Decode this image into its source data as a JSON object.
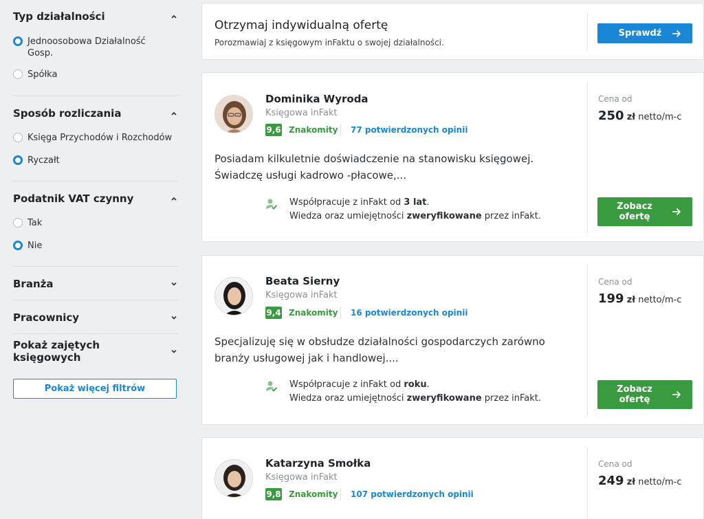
{
  "filters": {
    "type": {
      "title": "Typ działalności",
      "options": [
        "Jednoosobowa Działalność Gosp.",
        "Spółka"
      ],
      "selected": 0
    },
    "settlement": {
      "title": "Sposób rozliczania",
      "options": [
        "Księga Przychodów i Rozchodów",
        "Ryczałt"
      ],
      "selected": 1
    },
    "vat": {
      "title": "Podatnik VAT czynny",
      "options": [
        "Tak",
        "Nie"
      ],
      "selected": 1
    },
    "collapsed": [
      "Branża",
      "Pracownicy",
      "Pokaż zajętych księgowych"
    ],
    "more_button": "Pokaż więcej filtrów"
  },
  "promo": {
    "title": "Otrzymaj indywidualną ofertę",
    "subtitle": "Porozmawiaj z księgowym inFaktu o swojej działalności.",
    "button": "Sprawdź"
  },
  "accountants": [
    {
      "name": "Dominika Wyroda",
      "role": "Księgowa inFakt",
      "score": "9,6",
      "score_label": "Znakomity",
      "reviews": "77 potwierdzonych opinii",
      "desc_line1": "Posiadam kilkuletnie doświadczenie na stanowisku księgowej.",
      "desc_line2": "Świadczę usługi kadrowo -płacowe,...",
      "verify_pre": "Współpracuje z inFakt od ",
      "verify_bold": "3 lat",
      "verify_post": ".",
      "verify2_pre": "Wiedza oraz umiejętności ",
      "verify2_bold": "zweryfikowane",
      "verify2_post": " przez inFakt.",
      "price_label": "Cena od",
      "price_amount": "250",
      "price_currency": "zł",
      "price_unit": "netto/m-c",
      "button_line1": "Zobacz",
      "button_line2": "ofertę"
    },
    {
      "name": "Beata Sierny",
      "role": "Księgowa inFakt",
      "score": "9,4",
      "score_label": "Znakomity",
      "reviews": "16 potwierdzonych opinii",
      "desc_line1": "Specjalizuję się w obsłudze działalności gospodarczych zarówno",
      "desc_line2": "branży usługowej jak i handlowej....",
      "verify_pre": "Współpracuje z inFakt od ",
      "verify_bold": "roku",
      "verify_post": ".",
      "verify2_pre": "Wiedza oraz umiejętności ",
      "verify2_bold": "zweryfikowane",
      "verify2_post": " przez inFakt.",
      "price_label": "Cena od",
      "price_amount": "199",
      "price_currency": "zł",
      "price_unit": "netto/m-c",
      "button_line1": "Zobacz",
      "button_line2": "ofertę"
    },
    {
      "name": "Katarzyna Smołka",
      "role": "Księgowa inFakt",
      "score": "9,8",
      "score_label": "Znakomity",
      "reviews": "107 potwierdzonych opinii",
      "price_label": "Cena od",
      "price_amount": "249",
      "price_currency": "zł",
      "price_unit": "netto/m-c"
    }
  ],
  "colors": {
    "accent_blue": "#1a86d6",
    "accent_green": "#3a9a3f",
    "background": "#edeff1"
  },
  "icons": [
    "chevron-up-icon",
    "chevron-down-icon",
    "arrow-right-icon",
    "verified-user-icon"
  ]
}
